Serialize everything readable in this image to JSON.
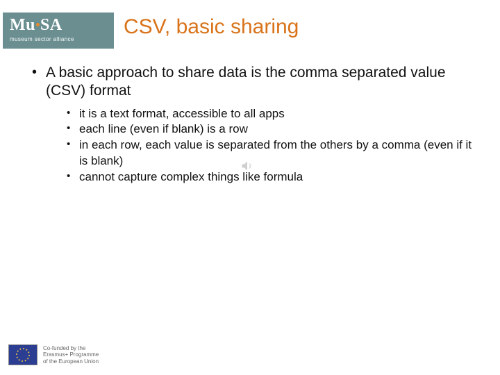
{
  "logo": {
    "line1_a": "Mu",
    "line1_b": "SA",
    "sub": "museum sector alliance"
  },
  "title": "CSV, basic sharing",
  "main_bullet": "A basic approach to share data is the comma separated value (CSV) format",
  "sub_bullets": [
    "it is a text format, accessible to all apps",
    "each line (even if blank) is a row",
    "in each row, each value is separated from the others by a comma (even if it is blank)",
    "cannot capture complex things like formula"
  ],
  "footer": {
    "l1": "Co-funded by the",
    "l2": "Erasmus+ Programme",
    "l3": "of the European Union"
  }
}
